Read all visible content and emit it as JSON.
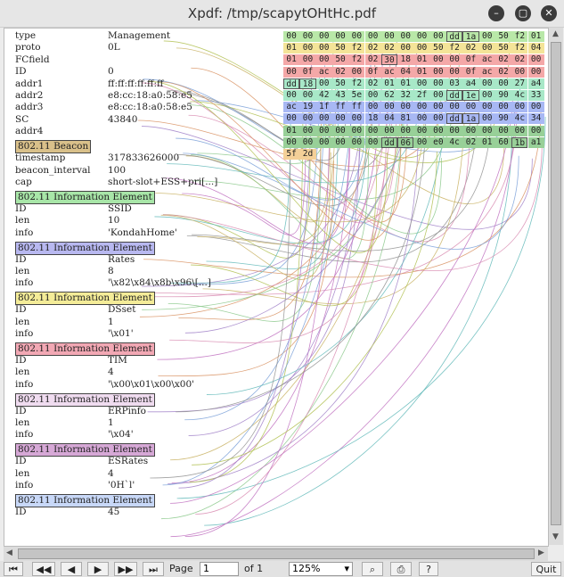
{
  "window": {
    "title": "Xpdf: /tmp/scapytOHtHc.pdf"
  },
  "dot11": [
    {
      "k": "type",
      "v": "Management"
    },
    {
      "k": "proto",
      "v": "0L"
    },
    {
      "k": "FCfield",
      "v": ""
    },
    {
      "k": "ID",
      "v": "0"
    },
    {
      "k": "addr1",
      "v": "ff:ff:ff:ff:ff:ff"
    },
    {
      "k": "addr2",
      "v": "e8:cc:18:a0:58:e5"
    },
    {
      "k": "addr3",
      "v": "e8:cc:18:a0:58:e5"
    },
    {
      "k": "SC",
      "v": "43840"
    },
    {
      "k": "addr4",
      "v": ""
    }
  ],
  "beacon": {
    "header": "802.11 Beacon",
    "color": "#d9c08a",
    "rows": [
      {
        "k": "timestamp",
        "v": "317833626000"
      },
      {
        "k": "beacon_interval",
        "v": "100"
      },
      {
        "k": "cap",
        "v": "short-slot+ESS+pri[...]"
      }
    ]
  },
  "elements": [
    {
      "header": "802.11 Information Element",
      "color": "#a8e6a8",
      "rows": [
        {
          "k": "ID",
          "v": "SSID"
        },
        {
          "k": "len",
          "v": "10"
        },
        {
          "k": "info",
          "v": "'KondahHome'"
        }
      ]
    },
    {
      "header": "802.11 Information Element",
      "color": "#b8b8f0",
      "rows": [
        {
          "k": "ID",
          "v": "Rates"
        },
        {
          "k": "len",
          "v": "8"
        },
        {
          "k": "info",
          "v": "'\\x82\\x84\\x8b\\x96\\[...]"
        }
      ]
    },
    {
      "header": "802.11 Information Element",
      "color": "#f4ec98",
      "rows": [
        {
          "k": "ID",
          "v": "DSset"
        },
        {
          "k": "len",
          "v": "1"
        },
        {
          "k": "info",
          "v": "'\\x01'"
        }
      ]
    },
    {
      "header": "802.11 Information Element",
      "color": "#f2a8b4",
      "rows": [
        {
          "k": "ID",
          "v": "TIM"
        },
        {
          "k": "len",
          "v": "4"
        },
        {
          "k": "info",
          "v": "'\\x00\\x01\\x00\\x00'"
        }
      ]
    },
    {
      "header": "802.11 Information Element",
      "color": "#f0dcf0",
      "rows": [
        {
          "k": "ID",
          "v": "ERPinfo"
        },
        {
          "k": "len",
          "v": "1"
        },
        {
          "k": "info",
          "v": "'\\x04'"
        }
      ]
    },
    {
      "header": "802.11 Information Element",
      "color": "#d6a8d6",
      "rows": [
        {
          "k": "ID",
          "v": "ESRates"
        },
        {
          "k": "len",
          "v": "4"
        },
        {
          "k": "info",
          "v": "'0H`l'"
        }
      ]
    },
    {
      "header": "802.11 Information Element",
      "color": "#c8d8f8",
      "rows": [
        {
          "k": "ID",
          "v": "45"
        }
      ]
    }
  ],
  "hexdump": [
    {
      "color": "#b9e8a8",
      "bytes": [
        "00",
        "00",
        "00",
        "00",
        "00",
        "00",
        "00",
        "00",
        "00",
        "00",
        "dd",
        "1a",
        "00",
        "50",
        "f2",
        "01"
      ]
    },
    {
      "color": "#f4e498",
      "bytes": [
        "01",
        "00",
        "00",
        "50",
        "f2",
        "02",
        "02",
        "00",
        "00",
        "50",
        "f2",
        "02",
        "00",
        "50",
        "f2",
        "04"
      ]
    },
    {
      "color": "#f4a8a8",
      "bytes": [
        "01",
        "00",
        "00",
        "50",
        "f2",
        "02",
        "30",
        "18",
        "01",
        "00",
        "00",
        "0f",
        "ac",
        "02",
        "02",
        "00"
      ]
    },
    {
      "color": "#f4a8a8",
      "bytes": [
        "00",
        "0f",
        "ac",
        "02",
        "00",
        "0f",
        "ac",
        "04",
        "01",
        "00",
        "00",
        "0f",
        "ac",
        "02",
        "00",
        "00"
      ]
    },
    {
      "color": "#a8e8c8",
      "bytes": [
        "dd",
        "18",
        "00",
        "50",
        "f2",
        "02",
        "01",
        "01",
        "00",
        "00",
        "03",
        "a4",
        "00",
        "00",
        "27",
        "a4"
      ]
    },
    {
      "color": "#a8e8c8",
      "bytes": [
        "00",
        "00",
        "42",
        "43",
        "5e",
        "00",
        "62",
        "32",
        "2f",
        "00",
        "dd",
        "1e",
        "00",
        "90",
        "4c",
        "33"
      ]
    },
    {
      "color": "#a8b8f4",
      "bytes": [
        "ac",
        "19",
        "1f",
        "ff",
        "ff",
        "00",
        "00",
        "00",
        "00",
        "00",
        "00",
        "00",
        "00",
        "00",
        "00",
        "00"
      ]
    },
    {
      "color": "#a8b8f4",
      "bytes": [
        "00",
        "00",
        "00",
        "00",
        "00",
        "18",
        "04",
        "81",
        "00",
        "00",
        "dd",
        "1a",
        "00",
        "90",
        "4c",
        "34"
      ]
    },
    {
      "color": "#98d098",
      "bytes": [
        "01",
        "00",
        "00",
        "00",
        "00",
        "00",
        "00",
        "00",
        "00",
        "00",
        "00",
        "00",
        "00",
        "00",
        "00",
        "00"
      ]
    },
    {
      "color": "#98d098",
      "bytes": [
        "00",
        "00",
        "00",
        "00",
        "00",
        "00",
        "dd",
        "06",
        "00",
        "e0",
        "4c",
        "02",
        "01",
        "60",
        "1b",
        "a1"
      ]
    },
    {
      "color": "#f4d098",
      "bytes": [
        "5f",
        "2d"
      ]
    }
  ],
  "toolbar": {
    "page_label": "Page",
    "page_value": "1",
    "of_label": "of 1",
    "zoom_value": "125%",
    "quit_label": "Quit"
  }
}
